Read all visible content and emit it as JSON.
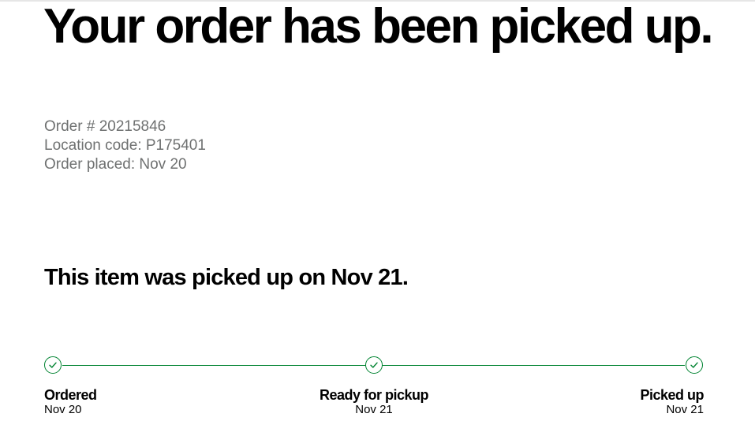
{
  "headline": "Your order has been picked up.",
  "order_info": {
    "order_number": "Order # 20215846",
    "location_code": "Location code: P175401",
    "order_placed": "Order placed: Nov 20"
  },
  "status_message": "This item was picked up on Nov 21.",
  "tracker": {
    "accent_color": "#008331",
    "steps": [
      {
        "label": "Ordered",
        "date": "Nov 20",
        "icon": "check-circle-icon",
        "completed": true
      },
      {
        "label": "Ready for pickup",
        "date": "Nov 21",
        "icon": "check-circle-icon",
        "completed": true
      },
      {
        "label": "Picked up",
        "date": "Nov 21",
        "icon": "check-circle-icon",
        "completed": true
      }
    ]
  }
}
